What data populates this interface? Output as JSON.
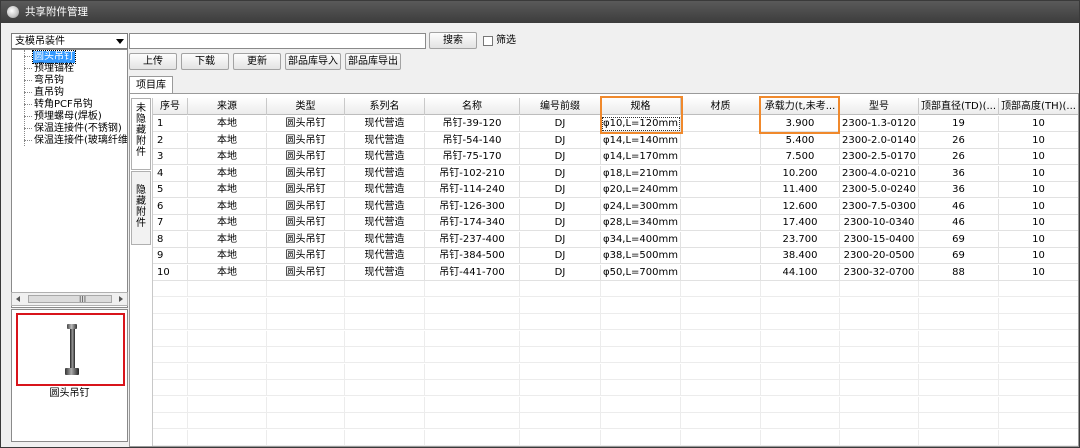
{
  "window": {
    "title": "共享附件管理"
  },
  "left": {
    "combo_value": "支模吊装件",
    "tree": [
      "圆头吊钉",
      "预埋锚栓",
      "弯吊钩",
      "直吊钩",
      "转角PCF吊钩",
      "预埋螺母(焊板)",
      "保温连接件(不锈钢)",
      "保温连接件(玻璃纤维)"
    ],
    "scroll_grip": "III",
    "preview_caption": "圆头吊钉"
  },
  "toolbar": {
    "search_placeholder": "",
    "search_button": "搜索",
    "filter_label": "筛选",
    "upload": "上传",
    "download": "下载",
    "update": "更新",
    "import": "部品库导入",
    "export": "部品库导出"
  },
  "tab_label": "项目库",
  "side_tabs": {
    "not_hidden": "未隐藏附件",
    "hidden": "隐藏附件"
  },
  "table": {
    "columns": [
      "序号",
      "来源",
      "类型",
      "系列名",
      "名称",
      "编号前缀",
      "规格",
      "材质",
      "承载力(t,未考...",
      "型号",
      "顶部直径(TD)(...",
      "顶部高度(TH)(..."
    ],
    "rows": [
      [
        "1",
        "本地",
        "圆头吊钉",
        "现代营造",
        "吊钉-39-120",
        "DJ",
        "φ10,L=120mm",
        "",
        "3.900",
        "2300-1.3-0120",
        "19",
        "10"
      ],
      [
        "2",
        "本地",
        "圆头吊钉",
        "现代营造",
        "吊钉-54-140",
        "DJ",
        "φ14,L=140mm",
        "",
        "5.400",
        "2300-2.0-0140",
        "26",
        "10"
      ],
      [
        "3",
        "本地",
        "圆头吊钉",
        "现代营造",
        "吊钉-75-170",
        "DJ",
        "φ14,L=170mm",
        "",
        "7.500",
        "2300-2.5-0170",
        "26",
        "10"
      ],
      [
        "4",
        "本地",
        "圆头吊钉",
        "现代营造",
        "吊钉-102-210",
        "DJ",
        "φ18,L=210mm",
        "",
        "10.200",
        "2300-4.0-0210",
        "36",
        "10"
      ],
      [
        "5",
        "本地",
        "圆头吊钉",
        "现代营造",
        "吊钉-114-240",
        "DJ",
        "φ20,L=240mm",
        "",
        "11.400",
        "2300-5.0-0240",
        "36",
        "10"
      ],
      [
        "6",
        "本地",
        "圆头吊钉",
        "现代营造",
        "吊钉-126-300",
        "DJ",
        "φ24,L=300mm",
        "",
        "12.600",
        "2300-7.5-0300",
        "46",
        "10"
      ],
      [
        "7",
        "本地",
        "圆头吊钉",
        "现代营造",
        "吊钉-174-340",
        "DJ",
        "φ28,L=340mm",
        "",
        "17.400",
        "2300-10-0340",
        "46",
        "10"
      ],
      [
        "8",
        "本地",
        "圆头吊钉",
        "现代营造",
        "吊钉-237-400",
        "DJ",
        "φ34,L=400mm",
        "",
        "23.700",
        "2300-15-0400",
        "69",
        "10"
      ],
      [
        "9",
        "本地",
        "圆头吊钉",
        "现代营造",
        "吊钉-384-500",
        "DJ",
        "φ38,L=500mm",
        "",
        "38.400",
        "2300-20-0500",
        "69",
        "10"
      ],
      [
        "10",
        "本地",
        "圆头吊钉",
        "现代营造",
        "吊钉-441-700",
        "DJ",
        "φ50,L=700mm",
        "",
        "44.100",
        "2300-32-0700",
        "88",
        "10"
      ]
    ]
  },
  "colors": {
    "highlight": "#f0892c",
    "preview_border": "#d8141b",
    "selection": "#3399ff"
  }
}
